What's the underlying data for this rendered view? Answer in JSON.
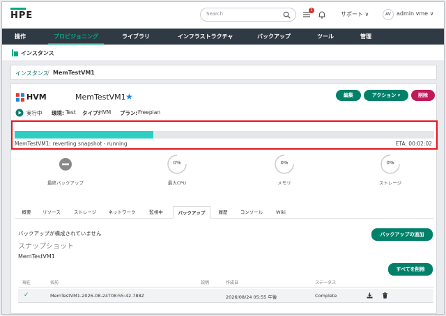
{
  "header": {
    "logo": "HPE",
    "search_placeholder": "Search",
    "notification_count": "1",
    "support_label": "サポート ∨",
    "avatar_initials": "AV",
    "user_label": "admin vme ∨"
  },
  "nav": {
    "items": [
      {
        "label": "操作"
      },
      {
        "label": "プロビジョニング"
      },
      {
        "label": "ライブラリ"
      },
      {
        "label": "インフラストラクチャ"
      },
      {
        "label": "バックアップ"
      },
      {
        "label": "ツール"
      },
      {
        "label": "管理"
      }
    ],
    "active_index": 1
  },
  "subheader": {
    "title": "インスタンス"
  },
  "breadcrumb": {
    "parent": "インスタンス",
    "separator": "/",
    "current": "MemTestVM1"
  },
  "instance": {
    "type_label": "HVM",
    "name": "MemTestVM1",
    "favorite_icon": "star-icon",
    "buttons": {
      "edit": "編集",
      "actions": "アクション ▾",
      "delete": "削除"
    },
    "status": "実行中",
    "environment_label": "環境:",
    "environment_value": "Test",
    "type_key": "タイプ:",
    "type_value": "HVM",
    "plan_label": "プラン:",
    "plan_value": "Freeplan"
  },
  "progress": {
    "value_fraction": 0.33,
    "label": "MemTestVM1: reverting snapshot - running",
    "eta": "ETA: 00:02:02",
    "color": "#2ccfc2"
  },
  "stats": [
    {
      "label": "最終バックアップ",
      "value": "",
      "icon": "minus-circle-icon"
    },
    {
      "label": "最大CPU",
      "value": "0%"
    },
    {
      "label": "メモリ",
      "value": "0%"
    },
    {
      "label": "ストレージ",
      "value": "0%"
    }
  ],
  "tabs": [
    {
      "label": "概要"
    },
    {
      "label": "リソース"
    },
    {
      "label": "ストレージ"
    },
    {
      "label": "ネットワーク"
    },
    {
      "label": "監視中"
    },
    {
      "label": "バックアップ"
    },
    {
      "label": "履歴"
    },
    {
      "label": "コンソール"
    },
    {
      "label": "Wiki"
    }
  ],
  "active_tab": 5,
  "backup": {
    "no_backup_text": "バックアップが構成されていません",
    "add_button": "バックアップの追加",
    "snapshots_title": "スナップショット",
    "vm_name": "MemTestVM1",
    "delete_all_button": "すべてを削除"
  },
  "table": {
    "headers": [
      "現在",
      "名前",
      "説明",
      "作成日",
      "ステータス"
    ],
    "rows": [
      {
        "current": "✓",
        "name": "MemTestVM1-2026-08-24T08:55:42.788Z",
        "description": "",
        "created": "2026/08/24 05:55 午後",
        "status": "Complete"
      }
    ]
  },
  "colors": {
    "accent": "#01a982",
    "button": "#01806a",
    "danger": "#c2185b",
    "nav_bg": "#2f3a45",
    "highlight_border": "#e8141c"
  }
}
